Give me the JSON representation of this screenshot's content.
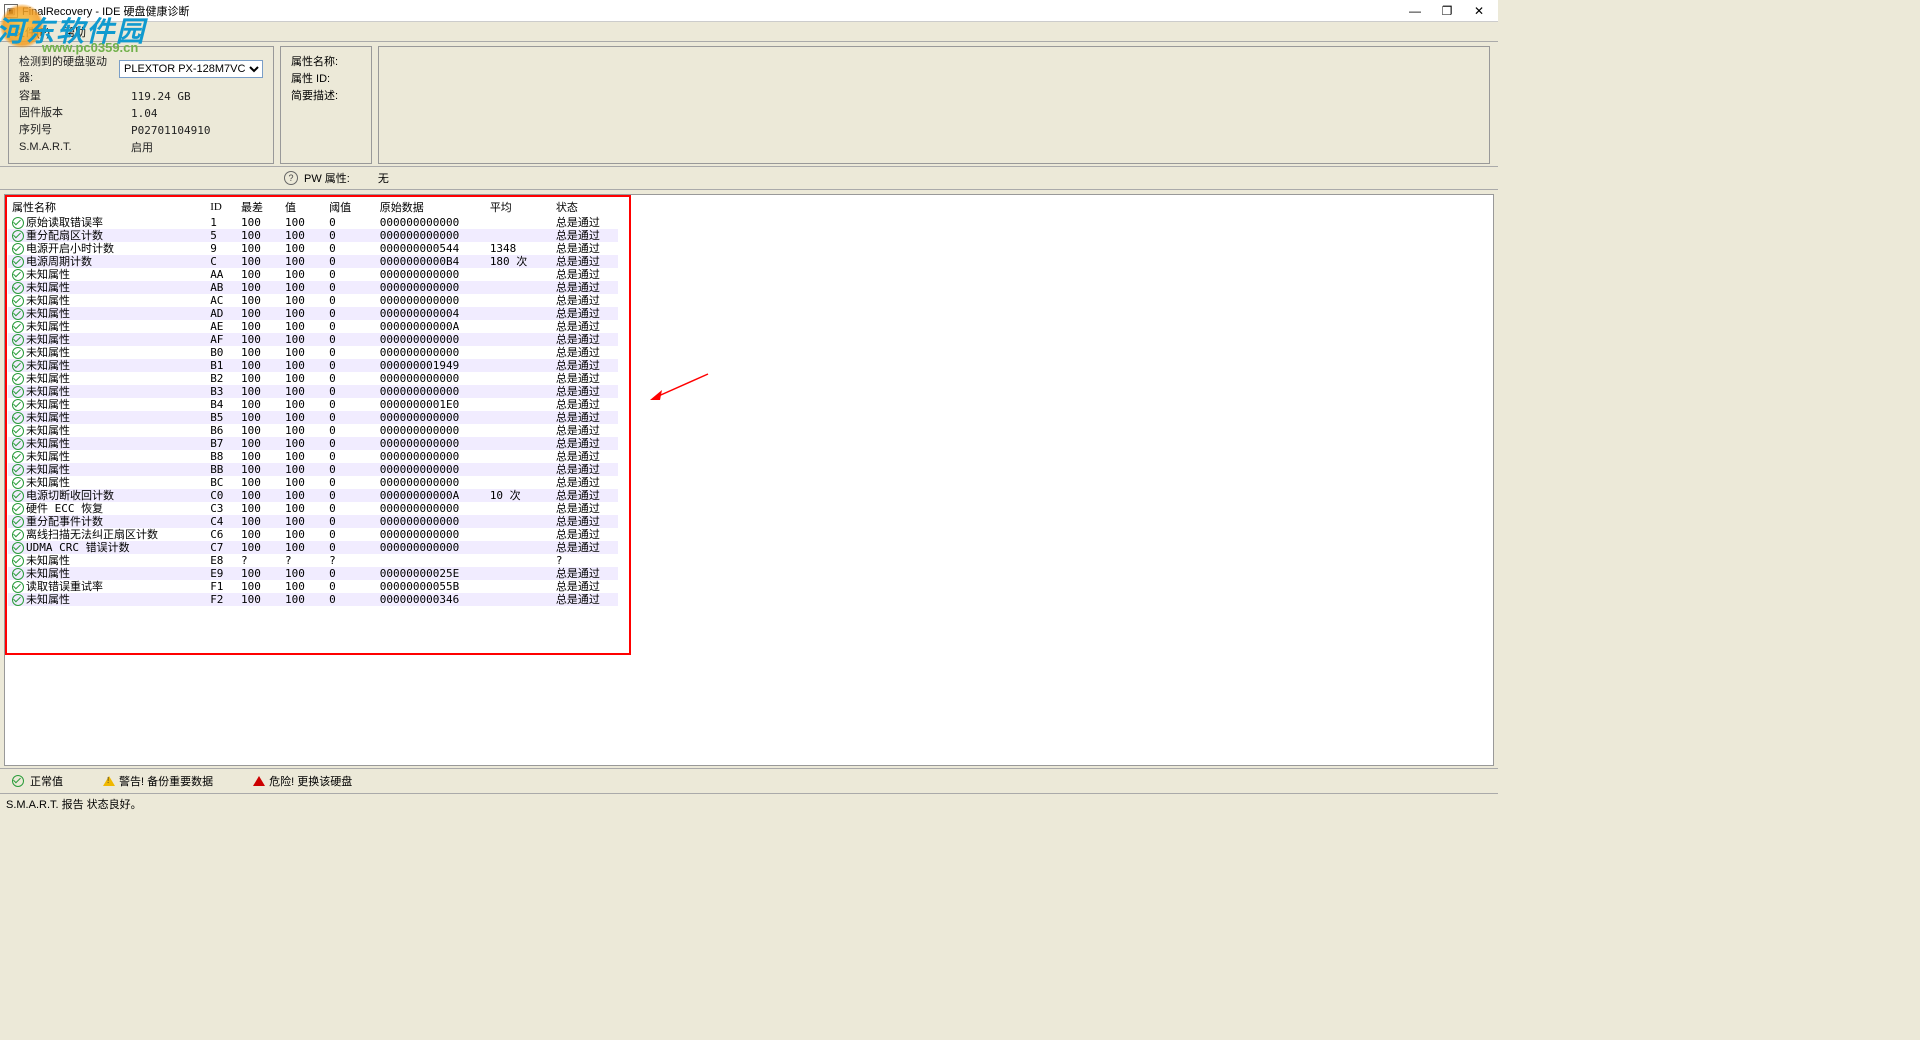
{
  "window": {
    "title": "FinalRecovery - IDE 硬盘健康诊断"
  },
  "menu": {
    "file": "文件(F)",
    "help": "帮助"
  },
  "watermark": {
    "text": "河东软件园",
    "url": "www.pc0359.cn"
  },
  "drive": {
    "label": "检测到的硬盘驱动器:",
    "selected": "PLEXTOR PX-128M7VC",
    "capacity_label": "容量",
    "capacity_value": "119.24 GB",
    "firmware_label": "固件版本",
    "firmware_value": "1.04",
    "serial_label": "序列号",
    "serial_value": "P02701104910",
    "smart_label": "S.M.A.R.T.",
    "smart_value": "启用"
  },
  "attr_panel": {
    "name": "属性名称:",
    "id": "属性 ID:",
    "desc": "简要描述:",
    "pw_label": "PW 属性:",
    "pw_value": "无"
  },
  "headers": {
    "name": "属性名称",
    "id": "ID",
    "worst": "最差",
    "value": "值",
    "threshold": "阈值",
    "raw": "原始数据",
    "avg": "平均",
    "status": "状态"
  },
  "rows": [
    {
      "name": "原始读取错误率",
      "id": "1",
      "worst": "100",
      "value": "100",
      "th": "0",
      "raw": "000000000000",
      "avg": "",
      "status": "总是通过"
    },
    {
      "name": "重分配扇区计数",
      "id": "5",
      "worst": "100",
      "value": "100",
      "th": "0",
      "raw": "000000000000",
      "avg": "",
      "status": "总是通过"
    },
    {
      "name": "电源开启小时计数",
      "id": "9",
      "worst": "100",
      "value": "100",
      "th": "0",
      "raw": "000000000544",
      "avg": "1348",
      "status": "总是通过"
    },
    {
      "name": "电源周期计数",
      "id": "C",
      "worst": "100",
      "value": "100",
      "th": "0",
      "raw": "0000000000B4",
      "avg": "180 次",
      "status": "总是通过"
    },
    {
      "name": "未知属性",
      "id": "AA",
      "worst": "100",
      "value": "100",
      "th": "0",
      "raw": "000000000000",
      "avg": "",
      "status": "总是通过"
    },
    {
      "name": "未知属性",
      "id": "AB",
      "worst": "100",
      "value": "100",
      "th": "0",
      "raw": "000000000000",
      "avg": "",
      "status": "总是通过"
    },
    {
      "name": "未知属性",
      "id": "AC",
      "worst": "100",
      "value": "100",
      "th": "0",
      "raw": "000000000000",
      "avg": "",
      "status": "总是通过"
    },
    {
      "name": "未知属性",
      "id": "AD",
      "worst": "100",
      "value": "100",
      "th": "0",
      "raw": "000000000004",
      "avg": "",
      "status": "总是通过"
    },
    {
      "name": "未知属性",
      "id": "AE",
      "worst": "100",
      "value": "100",
      "th": "0",
      "raw": "00000000000A",
      "avg": "",
      "status": "总是通过"
    },
    {
      "name": "未知属性",
      "id": "AF",
      "worst": "100",
      "value": "100",
      "th": "0",
      "raw": "000000000000",
      "avg": "",
      "status": "总是通过"
    },
    {
      "name": "未知属性",
      "id": "B0",
      "worst": "100",
      "value": "100",
      "th": "0",
      "raw": "000000000000",
      "avg": "",
      "status": "总是通过"
    },
    {
      "name": "未知属性",
      "id": "B1",
      "worst": "100",
      "value": "100",
      "th": "0",
      "raw": "000000001949",
      "avg": "",
      "status": "总是通过"
    },
    {
      "name": "未知属性",
      "id": "B2",
      "worst": "100",
      "value": "100",
      "th": "0",
      "raw": "000000000000",
      "avg": "",
      "status": "总是通过"
    },
    {
      "name": "未知属性",
      "id": "B3",
      "worst": "100",
      "value": "100",
      "th": "0",
      "raw": "000000000000",
      "avg": "",
      "status": "总是通过"
    },
    {
      "name": "未知属性",
      "id": "B4",
      "worst": "100",
      "value": "100",
      "th": "0",
      "raw": "0000000001E0",
      "avg": "",
      "status": "总是通过"
    },
    {
      "name": "未知属性",
      "id": "B5",
      "worst": "100",
      "value": "100",
      "th": "0",
      "raw": "000000000000",
      "avg": "",
      "status": "总是通过"
    },
    {
      "name": "未知属性",
      "id": "B6",
      "worst": "100",
      "value": "100",
      "th": "0",
      "raw": "000000000000",
      "avg": "",
      "status": "总是通过"
    },
    {
      "name": "未知属性",
      "id": "B7",
      "worst": "100",
      "value": "100",
      "th": "0",
      "raw": "000000000000",
      "avg": "",
      "status": "总是通过"
    },
    {
      "name": "未知属性",
      "id": "B8",
      "worst": "100",
      "value": "100",
      "th": "0",
      "raw": "000000000000",
      "avg": "",
      "status": "总是通过"
    },
    {
      "name": "未知属性",
      "id": "BB",
      "worst": "100",
      "value": "100",
      "th": "0",
      "raw": "000000000000",
      "avg": "",
      "status": "总是通过"
    },
    {
      "name": "未知属性",
      "id": "BC",
      "worst": "100",
      "value": "100",
      "th": "0",
      "raw": "000000000000",
      "avg": "",
      "status": "总是通过"
    },
    {
      "name": "电源切断收回计数",
      "id": "C0",
      "worst": "100",
      "value": "100",
      "th": "0",
      "raw": "00000000000A",
      "avg": "10 次",
      "status": "总是通过"
    },
    {
      "name": "硬件 ECC 恢复",
      "id": "C3",
      "worst": "100",
      "value": "100",
      "th": "0",
      "raw": "000000000000",
      "avg": "",
      "status": "总是通过"
    },
    {
      "name": "重分配事件计数",
      "id": "C4",
      "worst": "100",
      "value": "100",
      "th": "0",
      "raw": "000000000000",
      "avg": "",
      "status": "总是通过"
    },
    {
      "name": "离线扫描无法纠正扇区计数",
      "id": "C6",
      "worst": "100",
      "value": "100",
      "th": "0",
      "raw": "000000000000",
      "avg": "",
      "status": "总是通过"
    },
    {
      "name": "UDMA CRC 错误计数",
      "id": "C7",
      "worst": "100",
      "value": "100",
      "th": "0",
      "raw": "000000000000",
      "avg": "",
      "status": "总是通过"
    },
    {
      "name": "未知属性",
      "id": "E8",
      "worst": "?",
      "value": "?",
      "th": "?",
      "raw": "",
      "avg": "",
      "status": "?"
    },
    {
      "name": "未知属性",
      "id": "E9",
      "worst": "100",
      "value": "100",
      "th": "0",
      "raw": "00000000025E",
      "avg": "",
      "status": "总是通过"
    },
    {
      "name": "读取错误重试率",
      "id": "F1",
      "worst": "100",
      "value": "100",
      "th": "0",
      "raw": "00000000055B",
      "avg": "",
      "status": "总是通过"
    },
    {
      "name": "未知属性",
      "id": "F2",
      "worst": "100",
      "value": "100",
      "th": "0",
      "raw": "000000000346",
      "avg": "",
      "status": "总是通过"
    }
  ],
  "legend": {
    "ok": "正常值",
    "warn": "警告! 备份重要数据",
    "danger": "危险! 更换该硬盘"
  },
  "statusbar": "S.M.A.R.T. 报告 状态良好。"
}
